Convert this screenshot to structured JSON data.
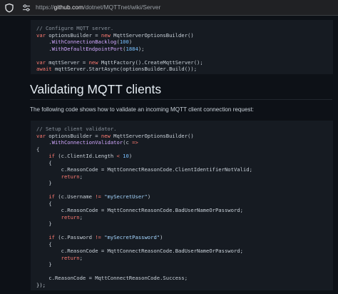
{
  "browser": {
    "url_prefix": "https://",
    "url_host": "github.com",
    "url_path": "/dotnet/MQTTnet/wiki/Server"
  },
  "content": {
    "heading": "Validating MQTT clients",
    "paragraph": "The following code shows how to validate an incoming MQTT client connection request:",
    "code_block_1": [
      [
        [
          "c",
          "// Configure MQTT server."
        ]
      ],
      [
        [
          "k",
          "var"
        ],
        [
          "p",
          " optionsBuilder = "
        ],
        [
          "k",
          "new"
        ],
        [
          "p",
          " MqttServerOptionsBuilder()"
        ]
      ],
      [
        [
          "p",
          "    ."
        ],
        [
          "f",
          "WithConnectionBacklog"
        ],
        [
          "p",
          "("
        ],
        [
          "n",
          "100"
        ],
        [
          "p",
          ")"
        ]
      ],
      [
        [
          "p",
          "    ."
        ],
        [
          "f",
          "WithDefaultEndpointPort"
        ],
        [
          "p",
          "("
        ],
        [
          "n",
          "1884"
        ],
        [
          "p",
          ");"
        ]
      ],
      [
        [
          "p",
          ""
        ]
      ],
      [
        [
          "k",
          "var"
        ],
        [
          "p",
          " mqttServer = "
        ],
        [
          "k",
          "new"
        ],
        [
          "p",
          " MqttFactory().CreateMqttServer();"
        ]
      ],
      [
        [
          "k",
          "await"
        ],
        [
          "p",
          " mqttServer.StartAsync(optionsBuilder.Build());"
        ]
      ]
    ],
    "code_block_2": [
      [
        [
          "c",
          "// Setup client validator."
        ]
      ],
      [
        [
          "k",
          "var"
        ],
        [
          "p",
          " optionsBuilder = "
        ],
        [
          "k",
          "new"
        ],
        [
          "p",
          " MqttServerOptionsBuilder()"
        ]
      ],
      [
        [
          "p",
          "    ."
        ],
        [
          "f",
          "WithConnectionValidator"
        ],
        [
          "p",
          "(c "
        ],
        [
          "k",
          "=>"
        ]
      ],
      [
        [
          "p",
          "{"
        ]
      ],
      [
        [
          "p",
          "    "
        ],
        [
          "k",
          "if"
        ],
        [
          "p",
          " (c.ClientId.Length "
        ],
        [
          "k",
          "<"
        ],
        [
          "p",
          " "
        ],
        [
          "n",
          "10"
        ],
        [
          "p",
          ")"
        ]
      ],
      [
        [
          "p",
          "    {"
        ]
      ],
      [
        [
          "p",
          "        c.ReasonCode = MqttConnectReasonCode.ClientIdentifierNotValid;"
        ]
      ],
      [
        [
          "p",
          "        "
        ],
        [
          "k",
          "return"
        ],
        [
          "p",
          ";"
        ]
      ],
      [
        [
          "p",
          "    }"
        ]
      ],
      [
        [
          "p",
          ""
        ]
      ],
      [
        [
          "p",
          "    "
        ],
        [
          "k",
          "if"
        ],
        [
          "p",
          " (c.Username "
        ],
        [
          "k",
          "!="
        ],
        [
          "p",
          " "
        ],
        [
          "s",
          "\"mySecretUser\""
        ],
        [
          "p",
          ")"
        ]
      ],
      [
        [
          "p",
          "    {"
        ]
      ],
      [
        [
          "p",
          "        c.ReasonCode = MqttConnectReasonCode.BadUserNameOrPassword;"
        ]
      ],
      [
        [
          "p",
          "        "
        ],
        [
          "k",
          "return"
        ],
        [
          "p",
          ";"
        ]
      ],
      [
        [
          "p",
          "    }"
        ]
      ],
      [
        [
          "p",
          ""
        ]
      ],
      [
        [
          "p",
          "    "
        ],
        [
          "k",
          "if"
        ],
        [
          "p",
          " (c.Password "
        ],
        [
          "k",
          "!="
        ],
        [
          "p",
          " "
        ],
        [
          "s",
          "\"mySecretPassword\""
        ],
        [
          "p",
          ")"
        ]
      ],
      [
        [
          "p",
          "    {"
        ]
      ],
      [
        [
          "p",
          "        c.ReasonCode = MqttConnectReasonCode.BadUserNameOrPassword;"
        ]
      ],
      [
        [
          "p",
          "        "
        ],
        [
          "k",
          "return"
        ],
        [
          "p",
          ";"
        ]
      ],
      [
        [
          "p",
          "    }"
        ]
      ],
      [
        [
          "p",
          ""
        ]
      ],
      [
        [
          "p",
          "    c.ReasonCode = MqttConnectReasonCode.Success;"
        ]
      ],
      [
        [
          "p",
          "});"
        ]
      ]
    ]
  }
}
